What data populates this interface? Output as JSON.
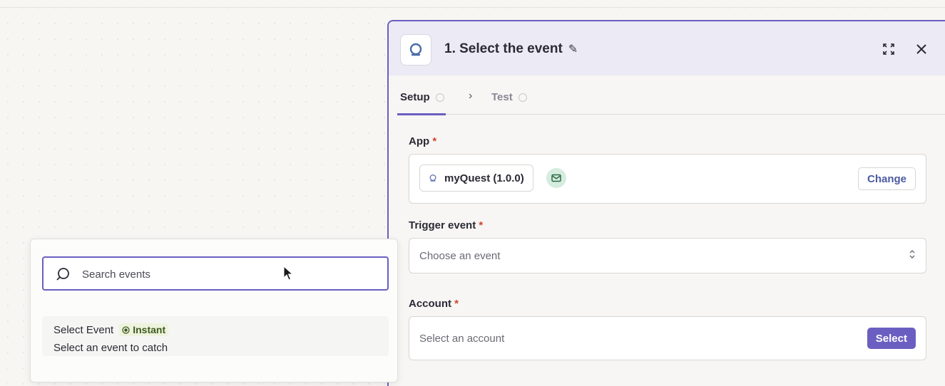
{
  "panel": {
    "title": "1. Select the event",
    "tabs": [
      {
        "label": "Setup"
      },
      {
        "label": "Test"
      }
    ]
  },
  "app_field": {
    "label": "App",
    "required_mark": "*",
    "app_name": "myQuest (1.0.0)",
    "change_label": "Change"
  },
  "trigger_field": {
    "label": "Trigger event",
    "required_mark": "*",
    "placeholder": "Choose an event"
  },
  "account_field": {
    "label": "Account",
    "required_mark": "*",
    "placeholder": "Select an account",
    "select_label": "Select"
  },
  "dropdown": {
    "search_placeholder": "Search events",
    "options": [
      {
        "title": "Select Event",
        "badge": "Instant",
        "description": "Select an event to catch"
      }
    ]
  },
  "colors": {
    "accent": "#6a5fc1",
    "required": "#d2452d",
    "instant_badge_bg": "#eef3de"
  }
}
